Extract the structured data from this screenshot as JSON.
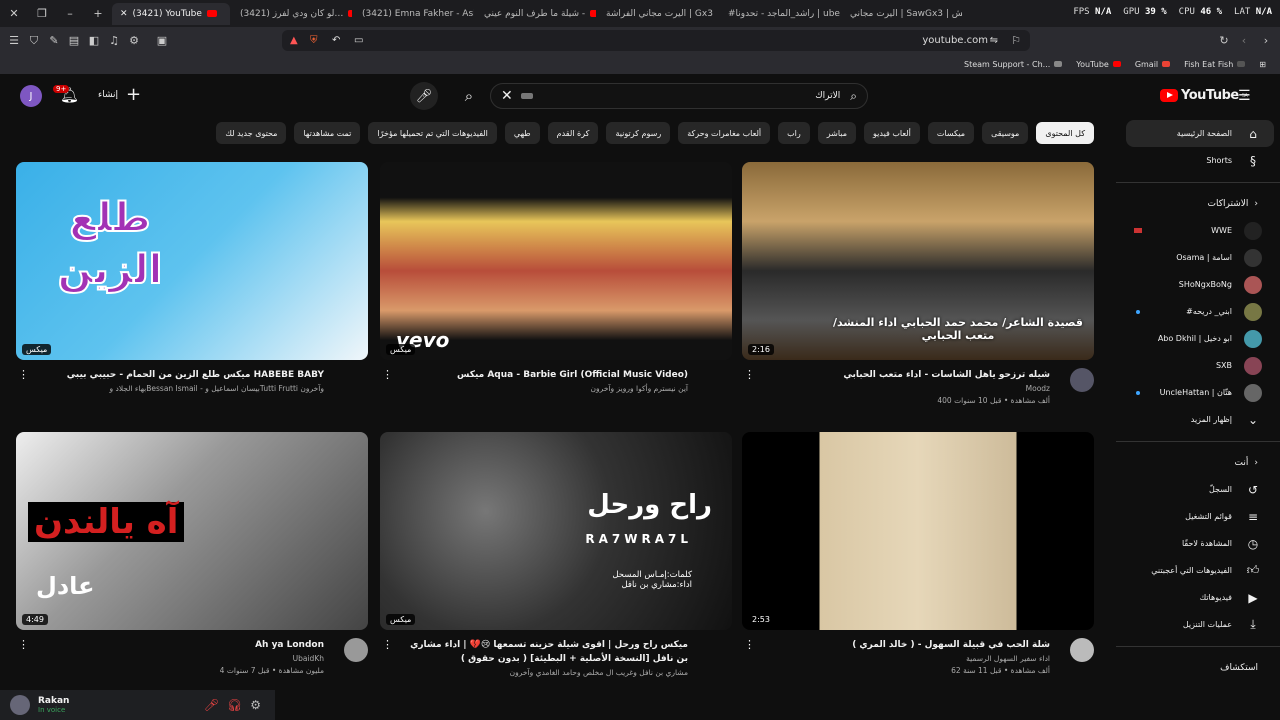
{
  "browser": {
    "tabs": [
      {
        "title": "(3421) YouTube",
        "active": true
      },
      {
        "title": "(3421) لو كان ودي لفرز…"
      },
      {
        "title": "(3421) Emna Fakher - Asla…"
      },
      {
        "title": "شيلة ما طرف النوم عيني -"
      },
      {
        "title": "اليرت مجاني الفراشة | Gx3"
      },
      {
        "title": "#راشد_الماجد - تحدونا | ube"
      },
      {
        "title": "اليرت مجاني | SawGx3 | الش…"
      }
    ],
    "hud": {
      "fps_label": "FPS",
      "fps": "N/A",
      "gpu_label": "GPU",
      "gpu": "39 %",
      "cpu_label": "CPU",
      "cpu": "46 %",
      "lat_label": "LAT",
      "lat": "N/A"
    },
    "url": "youtube.com",
    "bookmarks": [
      "Steam Support - Ch...",
      "YouTube",
      "Gmail",
      "Fish Eat Fish"
    ]
  },
  "masthead": {
    "avatar_letter": "J",
    "notif_count": "9+",
    "create_label": "إنشاء",
    "search_query": "الاتراك",
    "logo_text": "YouTube",
    "logo_region": "SA"
  },
  "chips": [
    "كل المحتوى",
    "موسيقى",
    "ميكسات",
    "ألعاب فيديو",
    "مباشر",
    "راب",
    "ألعاب مغامرات وحركة",
    "رسوم كرتونية",
    "كرة القدم",
    "طهي",
    "الفيديوهات التي تم تحميلها مؤخرًا",
    "تمت مشاهدتها",
    "محتوى جديد لك"
  ],
  "sidebar": {
    "home": "الصفحة الرئيسية",
    "shorts": "Shorts",
    "subs_header": "الاشتراكات",
    "channels": [
      {
        "name": "WWE",
        "color": "#222"
      },
      {
        "name": "Osama | اسامة",
        "color": "#333"
      },
      {
        "name": "SHoNgxBoNg",
        "color": "#a55"
      },
      {
        "name": "#ابني_ دريحه",
        "color": "#774"
      },
      {
        "name": "Abo Dkhil | ابو دخيل",
        "color": "#49a"
      },
      {
        "name": "SXB",
        "color": "#845"
      },
      {
        "name": "UncleHattan | هتّان",
        "color": "#666"
      }
    ],
    "show_more": "إظهار المزيد",
    "you_header": "أنت",
    "you_items": [
      "السجلّ",
      "قوائم التشغيل",
      "المشاهدة لاحقًا",
      "الفيديوهات التي أعجبتني",
      "فيديوهاتك",
      "عمليات التنزيل"
    ],
    "explore_header": "استكشاف"
  },
  "videos": [
    {
      "title": "شيله ترزحو ياهل الشاسات - اداء متعب الحبابي",
      "line2": "Moodz",
      "line3": "400 ألف مشاهدة • قبل 10 سنوات",
      "badge": "2:16",
      "thumb_text": "قصيدة الشاعر/ محمد حمد الحبابي اداء المنشد/متعب الحبابي"
    },
    {
      "title": "ميكس Aqua - Barbie Girl (Official Music Video)",
      "line2": "آين نيسترم وأكوا ورويز وآخرون",
      "line3": "",
      "badge": "ميكس",
      "thumb_text": "vevo"
    },
    {
      "title": "ميكس طلع الزين من الحمام - حبيبي بيبي HABEBE BABY",
      "line2": "بهاء الجلاد وBessan Ismail - بيسان اسماعيل وTutti Frutti وآخرون",
      "line3": "",
      "badge": "ميكس",
      "thumb_text": "طلع الزين"
    },
    {
      "title": "شلة الحب في قبيلة السهول - ( خالد المري )",
      "line2": "اداء سفير السهول الرسمية",
      "line3": "62 ألف مشاهدة • قبل 11 سنة",
      "badge": "2:53",
      "thumb_text": ""
    },
    {
      "title": "ميكس راح ورحل | اقوى شيلة حزينه تسمعها 😢💔 | اداء مشاري بن نافل [النسخة الأصلية + البطيئة] ( بدون حقوق )",
      "line2": "مشاري بن نافل وغريب ال مخلص وحامد الغامدي وآخرون",
      "line3": "",
      "badge": "ميكس",
      "thumb_text": "راح ورحل",
      "thumb_sub": "RA7WRA7L",
      "thumb_credit": "كلمات:إمـاس المسحل اداء:مشاري بن نافل"
    },
    {
      "title": "Ah ya London",
      "line2": "UbaidKh",
      "line3": "4 مليون مشاهدة • قبل 7 سنوات",
      "badge": "4:49",
      "thumb_text": "آه يالندن",
      "thumb_sub": "عادل"
    }
  ],
  "voice": {
    "user": "Rakan",
    "status": "In voice"
  }
}
